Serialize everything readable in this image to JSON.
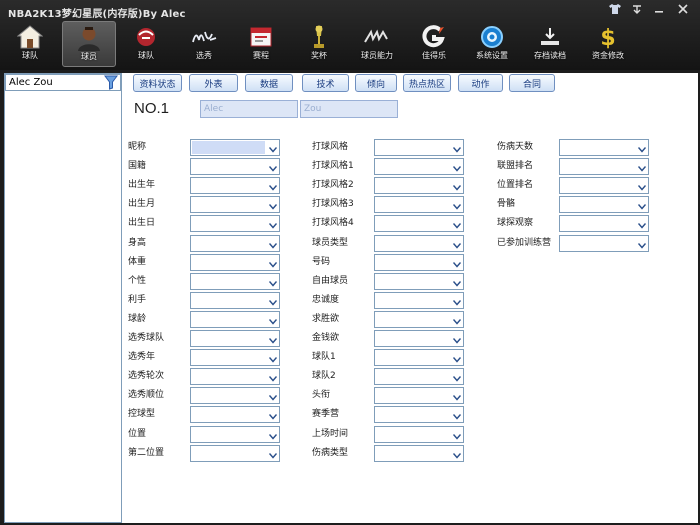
{
  "window": {
    "title": "NBA2K13梦幻星辰(内存版)By Alec",
    "controls": [
      "shirt-icon",
      "pin-icon",
      "minimize-icon",
      "close-icon"
    ]
  },
  "toolbar": {
    "items": [
      {
        "label": "球队",
        "icon": "house-icon"
      },
      {
        "label": "球员",
        "icon": "player-icon"
      },
      {
        "label": "球队",
        "icon": "team-logo-icon"
      },
      {
        "label": "选秀",
        "icon": "draft-icon"
      },
      {
        "label": "赛程",
        "icon": "schedule-icon"
      },
      {
        "label": "奖杯",
        "icon": "trophy-icon"
      },
      {
        "label": "球员能力",
        "icon": "ability-icon"
      },
      {
        "label": "佳得乐",
        "icon": "gatorade-icon"
      },
      {
        "label": "系统设置",
        "icon": "gear-icon"
      },
      {
        "label": "存档读档",
        "icon": "save-icon"
      },
      {
        "label": "资金修改",
        "icon": "dollar-icon"
      }
    ],
    "active_index": 1
  },
  "sidebar": {
    "search_value": "Alec Zou",
    "filter_icon": "filter-icon"
  },
  "tabs": [
    "资料状态",
    "外表",
    "数据",
    "技术",
    "倾向",
    "热点热区",
    "动作",
    "合同"
  ],
  "player": {
    "number_label": "NO.1",
    "first_name": "Alec",
    "last_name": "Zou"
  },
  "fields": {
    "col1": [
      "昵称",
      "国籍",
      "出生年",
      "出生月",
      "出生日",
      "身高",
      "体重",
      "个性",
      "利手",
      "球龄",
      "选秀球队",
      "选秀年",
      "选秀轮次",
      "选秀顺位",
      "控球型",
      "位置",
      "第二位置"
    ],
    "col2": [
      "打球风格",
      "打球风格1",
      "打球风格2",
      "打球风格3",
      "打球风格4",
      "球员类型",
      "号码",
      "自由球员",
      "忠诚度",
      "求胜欲",
      "金钱欲",
      "球队1",
      "球队2",
      "头衔",
      "赛季营",
      "上场时间",
      "伤病类型"
    ],
    "col3": [
      "伤病天数",
      "联盟排名",
      "位置排名",
      "骨骼",
      "球探观察",
      "已参加训练营"
    ]
  },
  "colors": {
    "header_bg": "#1d1d1d",
    "tab_text": "#1a3c80",
    "tab_border": "#6f8fc0",
    "combo_border": "#7f9db9",
    "combo_highlight": "#cfdcf6"
  }
}
